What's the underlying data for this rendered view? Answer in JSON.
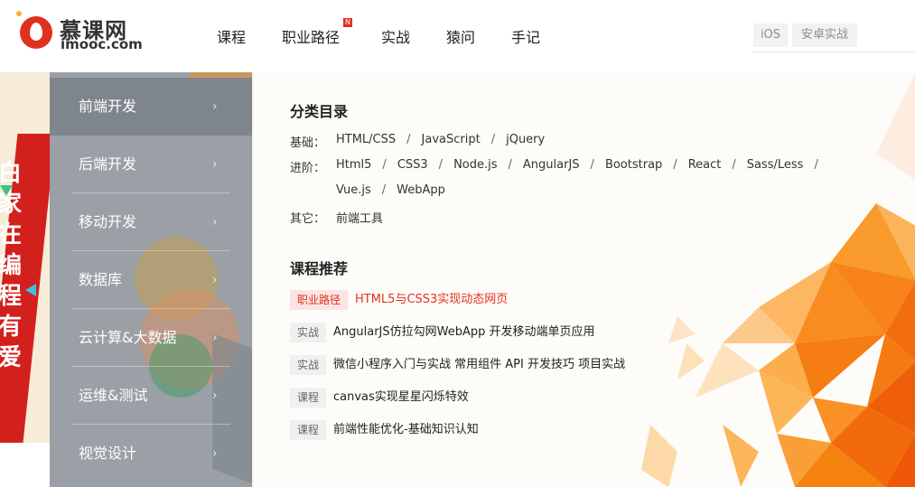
{
  "logo": {
    "cn": "慕课网",
    "en": "imooc.com"
  },
  "nav": {
    "items": [
      {
        "label": "课程"
      },
      {
        "label": "职业路径",
        "badge": "N"
      },
      {
        "label": "实战"
      },
      {
        "label": "猿问"
      },
      {
        "label": "手记"
      }
    ]
  },
  "top_right": {
    "buttons": [
      "iOS",
      "安卓实战"
    ]
  },
  "banner": {
    "text": "白家在编程有爱"
  },
  "sidebar": {
    "items": [
      {
        "label": "前端开发",
        "active": true
      },
      {
        "label": "后端开发"
      },
      {
        "label": "移动开发"
      },
      {
        "label": "数据库"
      },
      {
        "label": "云计算&大数据"
      },
      {
        "label": "运维&测试"
      },
      {
        "label": "视觉设计"
      }
    ],
    "chevron": "›"
  },
  "catalog": {
    "title": "分类目录",
    "rows": [
      {
        "label": "基础：",
        "links": [
          "HTML/CSS",
          "JavaScript",
          "jQuery"
        ]
      },
      {
        "label": "进阶：",
        "links": [
          "Html5",
          "CSS3",
          "Node.js",
          "AngularJS",
          "Bootstrap",
          "React",
          "Sass/Less"
        ]
      },
      {
        "label": "",
        "links": [
          "Vue.js",
          "WebApp"
        ]
      },
      {
        "label": "其它：",
        "links": [
          "前端工具"
        ]
      }
    ]
  },
  "recommend": {
    "title": "课程推荐",
    "items": [
      {
        "tag": "职业路径",
        "title": "HTML5与CSS3实现动态网页",
        "highlight": true
      },
      {
        "tag": "实战",
        "title": "AngularJS仿拉勾网WebApp 开发移动端单页应用"
      },
      {
        "tag": "实战",
        "title": "微信小程序入门与实战 常用组件 API 开发技巧 项目实战"
      },
      {
        "tag": "课程",
        "title": "canvas实现星星闪烁特效"
      },
      {
        "tag": "课程",
        "title": "前端性能优化-基础知识认知"
      }
    ]
  },
  "colors": {
    "brand_red": "#e0311d",
    "sidebar_bg": "#9aa0a6",
    "poly_orange": "#f7931e"
  }
}
